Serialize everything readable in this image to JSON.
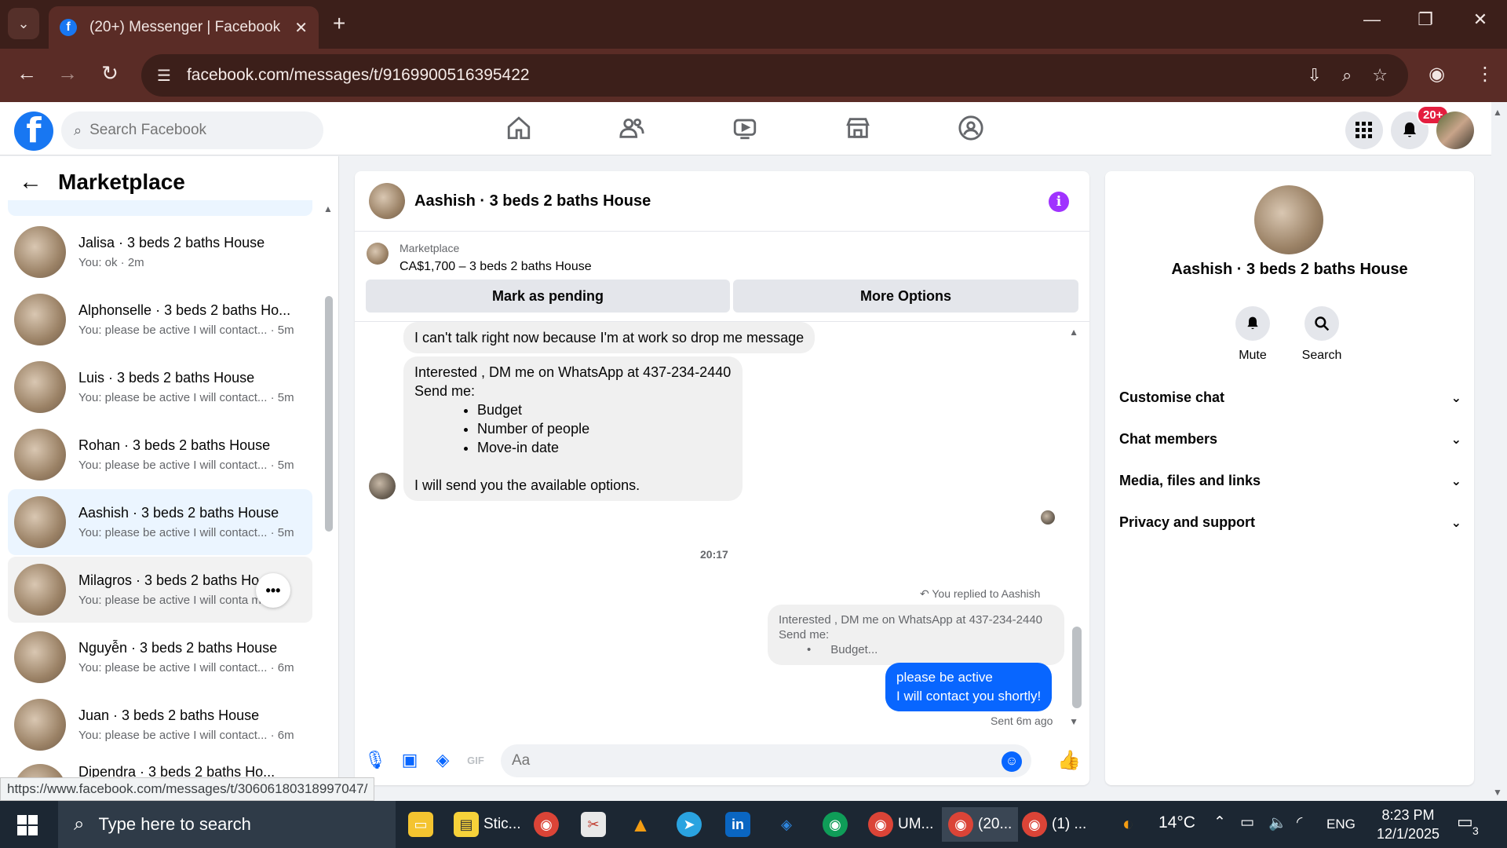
{
  "browser": {
    "tab_title": "(20+) Messenger | Facebook",
    "url": "facebook.com/messages/t/9169900516395422",
    "status_url": "https://www.facebook.com/messages/t/30606180318997047/"
  },
  "fb": {
    "search_placeholder": "Search Facebook",
    "notification_badge": "20+"
  },
  "left": {
    "title": "Marketplace",
    "conversations": [
      {
        "name": "Jalisa · 3 beds 2 baths House",
        "preview": "You: ok · 2m"
      },
      {
        "name": "Alphonselle · 3 beds 2 baths Ho...",
        "preview": "You: please be active I will contact... · 5m"
      },
      {
        "name": "Luis · 3 beds 2 baths House",
        "preview": "You: please be active I will contact... · 5m"
      },
      {
        "name": "Rohan · 3 beds 2 baths House",
        "preview": "You: please be active I will contact... · 5m"
      },
      {
        "name": "Aashish · 3 beds 2 baths House",
        "preview": "You: please be active I will contact... · 5m"
      },
      {
        "name": "Milagros · 3 beds 2 baths Ho",
        "preview": "You: please be active I will conta m"
      },
      {
        "name": "Nguyễn · 3 beds 2 baths House",
        "preview": "You: please be active I will contact... · 6m"
      },
      {
        "name": "Juan · 3 beds 2 baths House",
        "preview": "You: please be active I will contact... · 6m"
      },
      {
        "name": "Dipendra · 3 beds 2 baths Ho...",
        "preview": ""
      }
    ]
  },
  "chat": {
    "title": "Aashish · 3 beds 2 baths House",
    "listing_label": "Marketplace",
    "listing_price": "CA$1,700 – 3 beds 2 baths House",
    "btn_pending": "Mark as pending",
    "btn_more": "More Options",
    "msg1": "I can't talk right now because I'm at work so drop me message",
    "msg2_line1": "Interested , DM me on WhatsApp at 437-234-2440",
    "msg2_line2": "Send me:",
    "msg2_items": [
      "Budget",
      "Number of people",
      "Move-in date"
    ],
    "msg2_footer": "I will send you the available options.",
    "time_divider": "20:17",
    "replied_to": "You replied to Aashish",
    "quote_line1": "Interested , DM me on WhatsApp at 437-234-2440",
    "quote_line2": "Send me:",
    "quote_item": "Budget...",
    "out_line1": "please be active",
    "out_line2": "I will contact you shortly!",
    "sent_status": "Sent 6m ago",
    "composer_placeholder": "Aa"
  },
  "right": {
    "name": "Aashish · 3 beds 2 baths House",
    "mute_label": "Mute",
    "search_label": "Search",
    "sections": [
      "Customise chat",
      "Chat members",
      "Media, files and links",
      "Privacy and support"
    ]
  },
  "taskbar": {
    "search_placeholder": "Type here to search",
    "apps": [
      "Stic...",
      "UM...",
      "(20...",
      "(1) ..."
    ],
    "weather": "14°C",
    "lang": "ENG",
    "time": "8:23 PM",
    "date": "12/1/2025",
    "notif_count": "3"
  }
}
